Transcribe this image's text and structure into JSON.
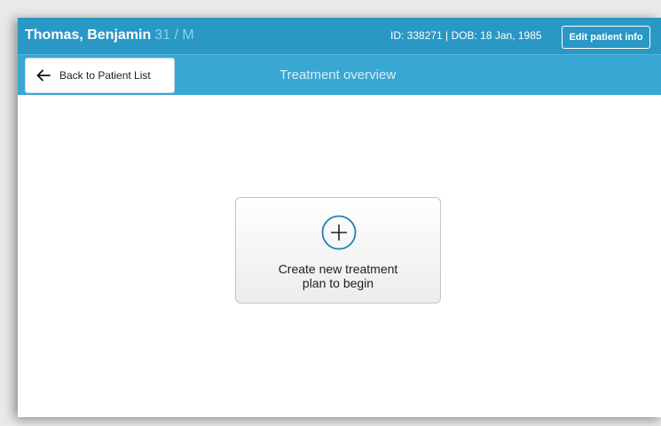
{
  "patient": {
    "name": "Thomas, Benjamin",
    "age_sex": "31 / M",
    "id_dob": "ID: 338271 | DOB: 18 Jan, 1985"
  },
  "header": {
    "edit_label": "Edit patient info"
  },
  "nav": {
    "back_label": "Back to Patient List",
    "title": "Treatment overview"
  },
  "main": {
    "create_line1": "Create new treatment",
    "create_line2": "plan to begin"
  },
  "colors": {
    "header_bar": "#2a98c4",
    "sub_bar": "#39a7d3",
    "accent_icon": "#1f83b0"
  },
  "icons": {
    "back": "arrow-left-icon",
    "create": "plus-circle-icon"
  }
}
